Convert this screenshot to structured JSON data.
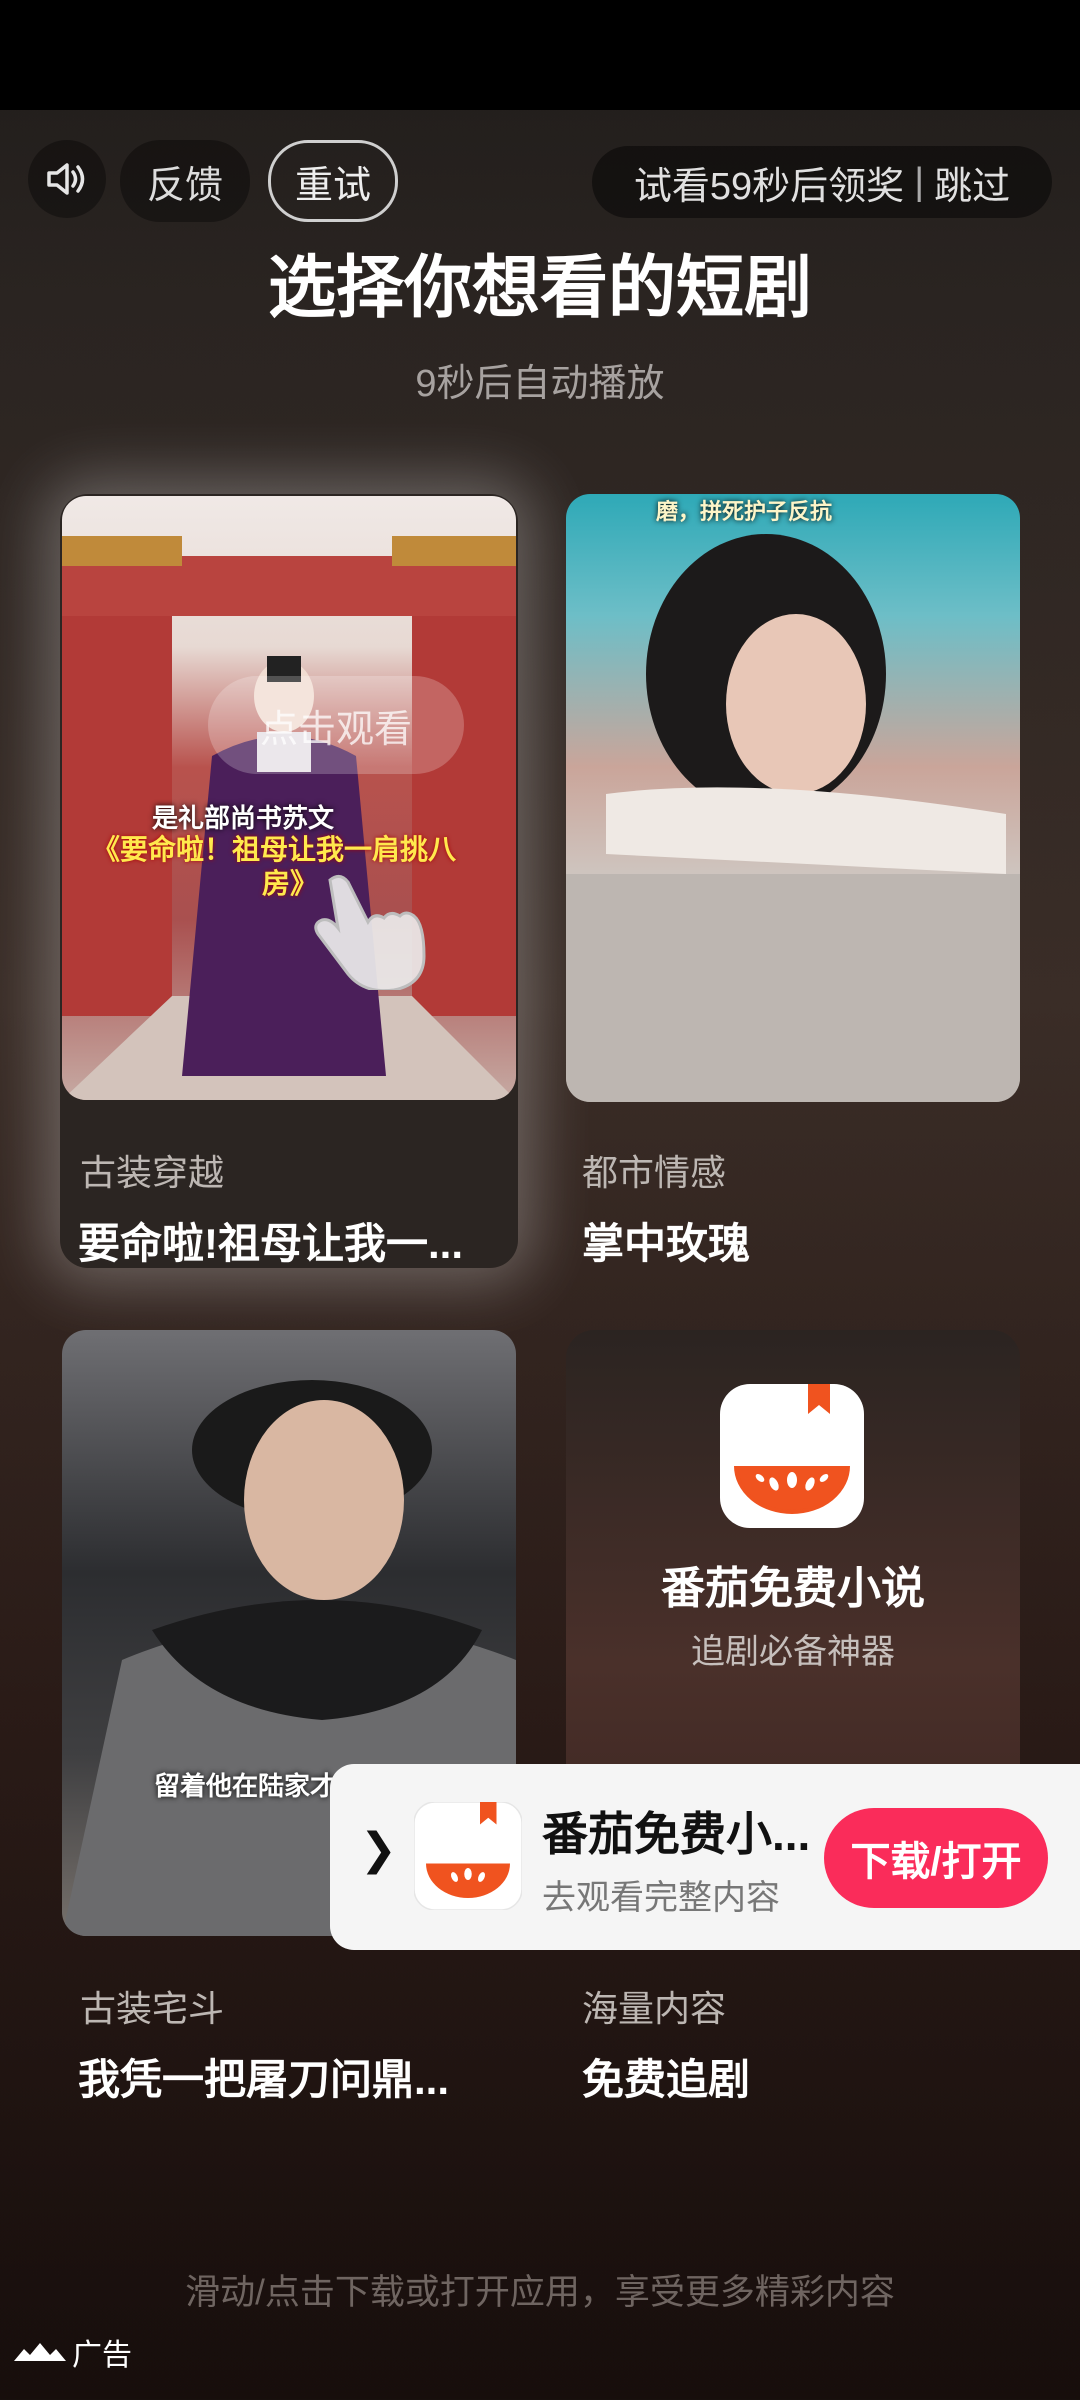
{
  "header": {
    "feedback_label": "反馈",
    "retry_label": "重试",
    "reward_text": "试看59秒后领奖",
    "separator": "|",
    "skip_label": "跳过"
  },
  "title": "选择你想看的短剧",
  "auto_play_text": "9秒后自动播放",
  "cards": [
    {
      "genre": "古装穿越",
      "title": "要命啦!祖母让我一...",
      "caption_line": "是礼部尚书苏文",
      "caption_title_1": "《要命啦！祖母让我一肩挑八",
      "caption_title_2": "房》",
      "click_hint": "点击观看"
    },
    {
      "genre": "都市情感",
      "title": "掌中玫瑰",
      "top_caption": "磨，拼死护子反抗"
    },
    {
      "genre": "古装宅斗",
      "title": "我凭一把屠刀问鼎...",
      "caption_line": "留着他在陆家才"
    },
    {
      "genre": "海量内容",
      "title": "免费追剧",
      "app_name": "番茄免费小说",
      "app_slogan": "追剧必备神器"
    }
  ],
  "download_banner": {
    "app_name": "番茄免费小...",
    "subtitle": "去观看完整内容",
    "button_label": "下载/打开"
  },
  "footer_hint": "滑动/点击下载或打开应用，享受更多精彩内容",
  "ad_label": "广告",
  "colors": {
    "accent": "#fa2c5a",
    "logo_orange": "#f0531f"
  }
}
